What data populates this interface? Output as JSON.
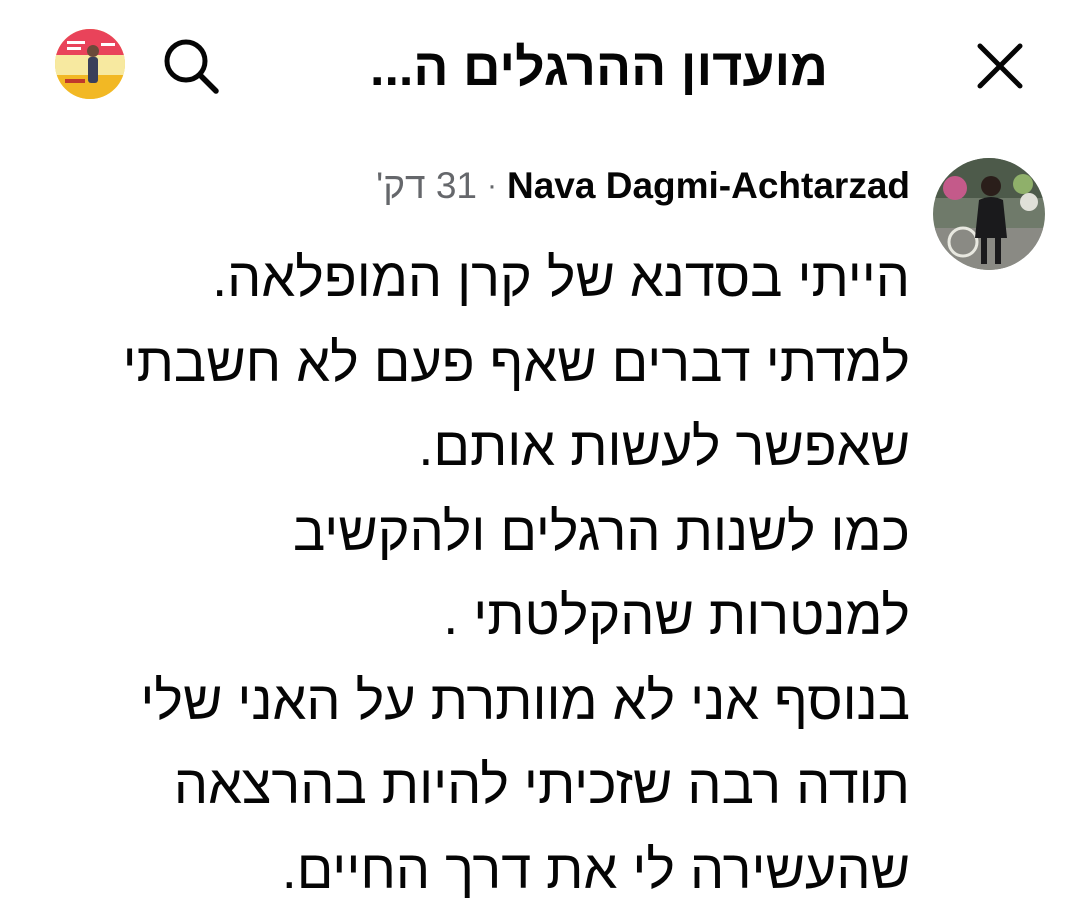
{
  "header": {
    "title": "מועדון ההרגלים ה...",
    "close_icon": "close-icon",
    "search_icon": "search-icon",
    "group_avatar_icon": "group-avatar-image"
  },
  "post": {
    "author": "Nava Dagmi-Achtarzad",
    "separator": "·",
    "timestamp": "31 דק'",
    "author_avatar_icon": "author-avatar-image",
    "lines": [
      "הייתי בסדנא של קרן המופלאה.",
      "למדתי דברים שאף פעם לא חשבתי",
      "שאפשר לעשות אותם.",
      "כמו לשנות הרגלים ולהקשיב",
      "למנטרות שהקלטתי .",
      "בנוסף אני לא מוותרת על האני שלי",
      "תודה רבה שזכיתי להיות בהרצאה",
      "שהעשירה לי את דרך החיים."
    ]
  },
  "colors": {
    "text": "#050505",
    "secondary_text": "#65676b",
    "background": "#ffffff"
  }
}
